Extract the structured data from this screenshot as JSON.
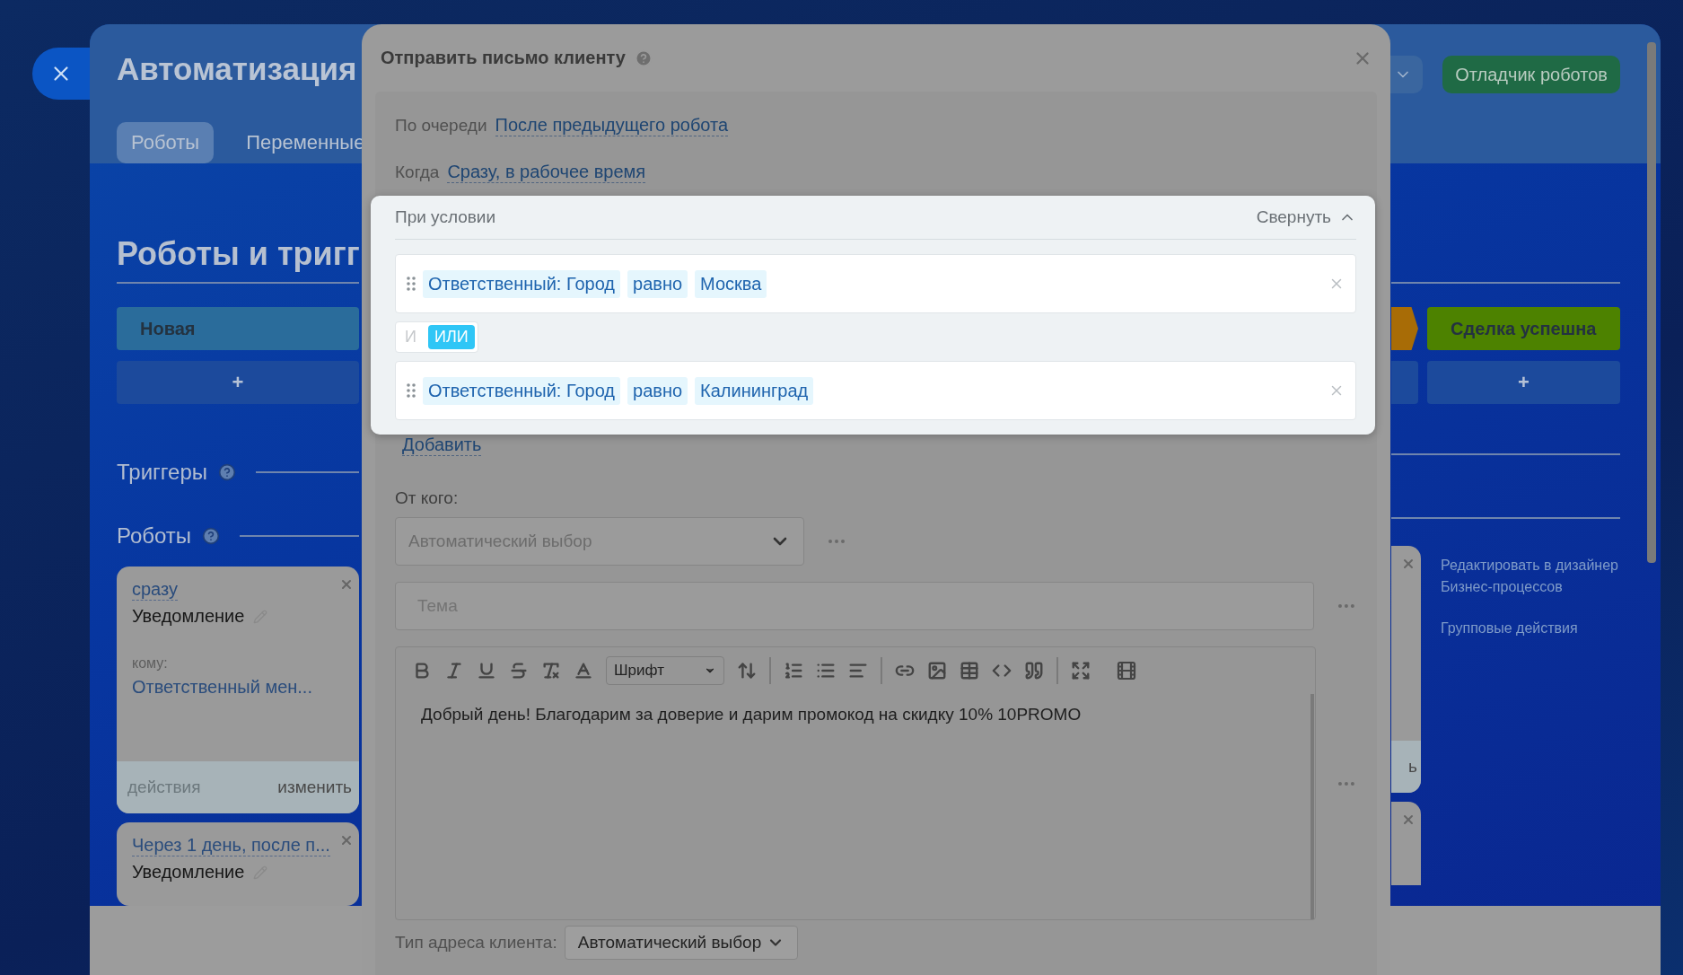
{
  "header": {
    "title": "Автоматизация",
    "tabs": [
      {
        "label": "Роботы",
        "selected": true
      },
      {
        "label": "Переменные",
        "selected": false
      }
    ],
    "debugger_button": "Отладчик роботов"
  },
  "page_title": "Роботы и тригг",
  "stages_left": [
    {
      "name": "Новая",
      "color": "#2a6c9b"
    }
  ],
  "stages_right": [
    {
      "kind": "tip",
      "color": "#a86c06"
    },
    {
      "kind": "stage",
      "name": "Сделка успешна",
      "color": "#4d8200"
    }
  ],
  "add_stage_button": "+",
  "sections": {
    "triggers": "Триггеры",
    "robots": "Роботы"
  },
  "robots": [
    {
      "delay": "сразу",
      "type": "Уведомление",
      "to_label": "кому:",
      "to": "Ответственный мен...",
      "actions": "действия",
      "edit": "изменить"
    },
    {
      "delay": "Через 1 день, после п...",
      "type": "Уведомление"
    }
  ],
  "right_card_footer": "ь",
  "side_links": [
    {
      "lines": [
        "Редактировать в дизайнер",
        "Бизнес-процессов"
      ]
    },
    {
      "lines": [
        "Групповые действия"
      ]
    }
  ],
  "modal": {
    "title": "Отправить письмо клиенту",
    "order_label": "По очереди",
    "order_value": "После предыдущего робота",
    "when_label": "Когда",
    "when_value": "Сразу, в рабочее время",
    "condition": {
      "title": "При условии",
      "collapse": "Свернуть",
      "rows": [
        {
          "field": "Ответственный: Город",
          "operator": "равно",
          "value": "Москва"
        },
        {
          "field": "Ответственный: Город",
          "operator": "равно",
          "value": "Калининград"
        }
      ],
      "joiners": [
        {
          "label": "И",
          "selected": false
        },
        {
          "label": "ИЛИ",
          "selected": true
        }
      ]
    },
    "add_link": "Добавить",
    "from_label": "От кого:",
    "from_value": "Автоматический выбор",
    "subject_placeholder": "Тема",
    "font_select": "Шрифт",
    "body": "Добрый день! Благодарим за доверие и дарим промокод на скидку 10% 10PROMO",
    "address_type_label": "Тип адреса клиента:",
    "address_type_value": "Автоматический выбор"
  }
}
